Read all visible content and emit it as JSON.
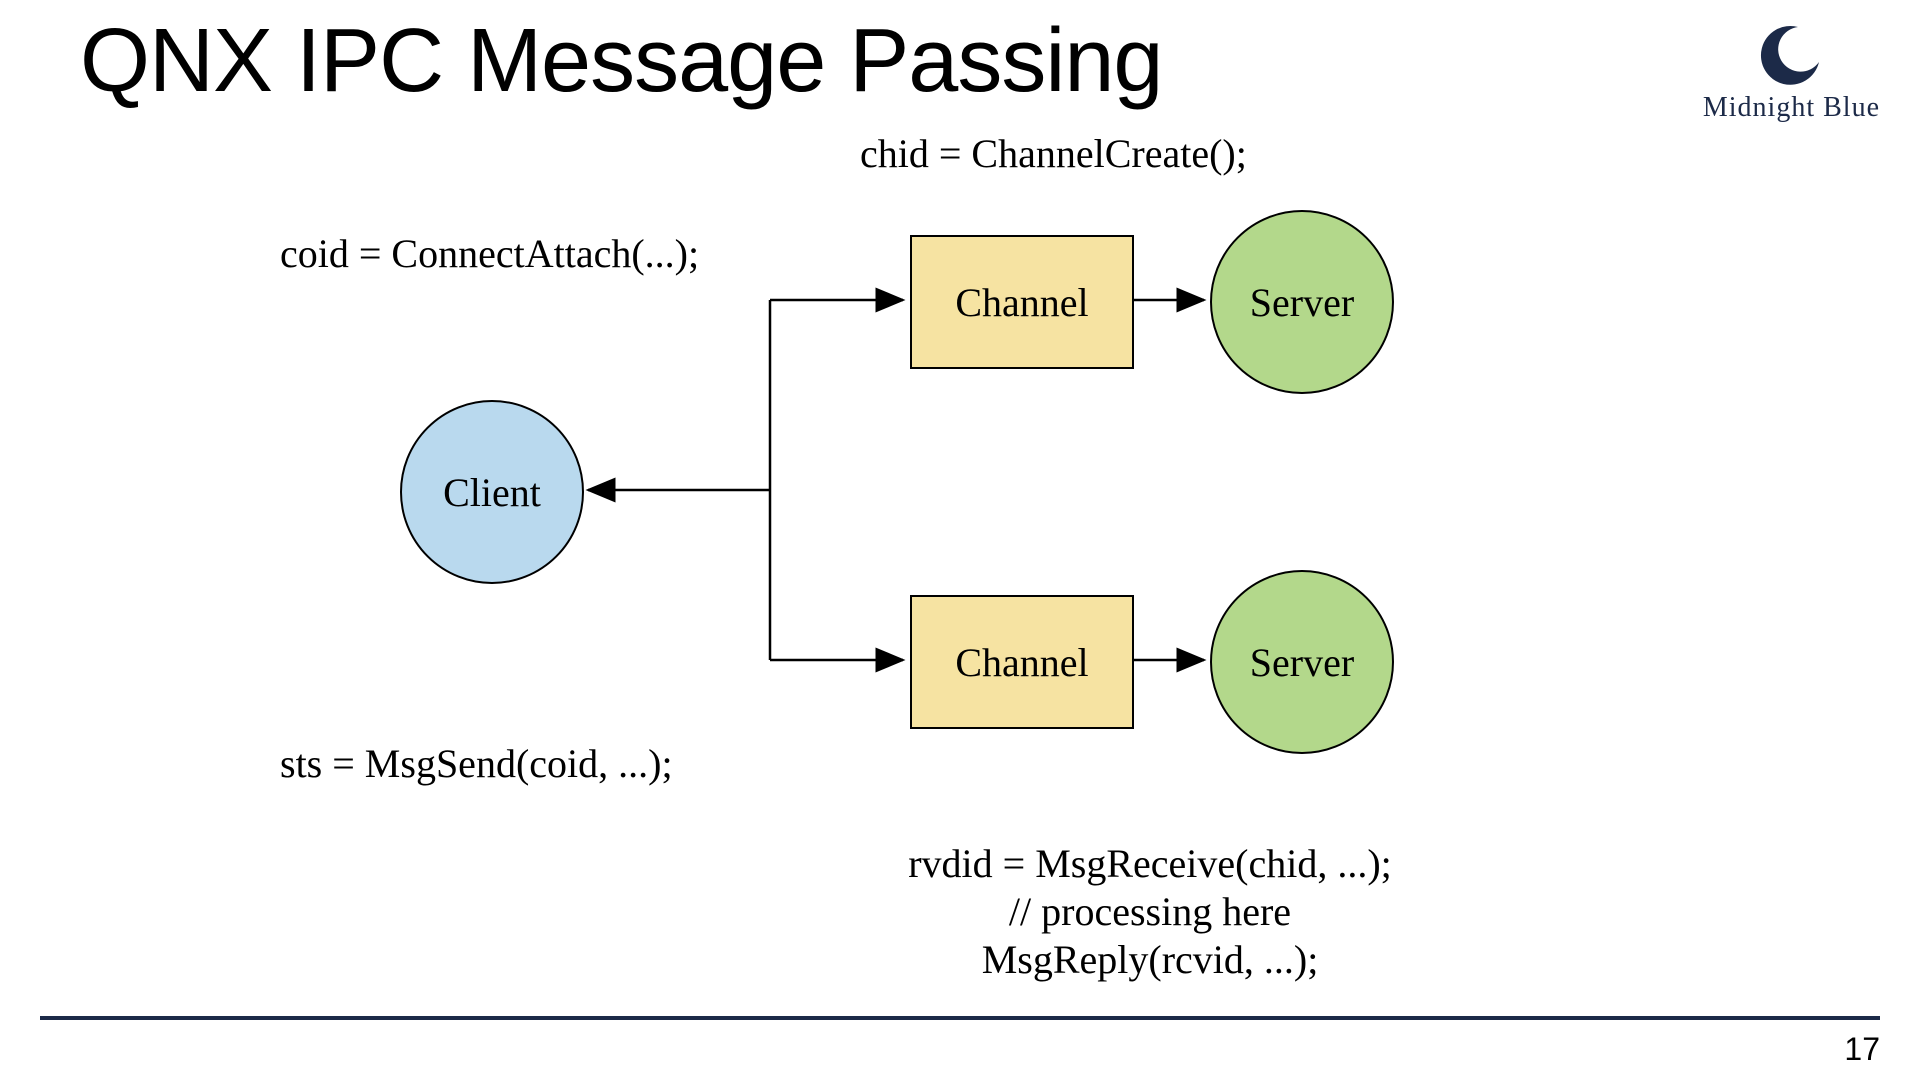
{
  "title": "QNX IPC Message Passing",
  "brand": "Midnight Blue",
  "labels": {
    "chid": "chid = ChannelCreate();",
    "coid": "coid = ConnectAttach(...);",
    "sts": "sts = MsgSend(coid, ...);",
    "recv_line1": "rvdid = MsgReceive(chid, ...);",
    "recv_line2": "// processing here",
    "recv_line3": "MsgReply(rcvid, ...);"
  },
  "nodes": {
    "client": "Client",
    "channel": "Channel",
    "server": "Server"
  },
  "page": "17",
  "colors": {
    "client_fill": "#b9d9ee",
    "channel_fill": "#f6e3a2",
    "server_fill": "#b3d88b",
    "brand_navy": "#1c2a48"
  }
}
